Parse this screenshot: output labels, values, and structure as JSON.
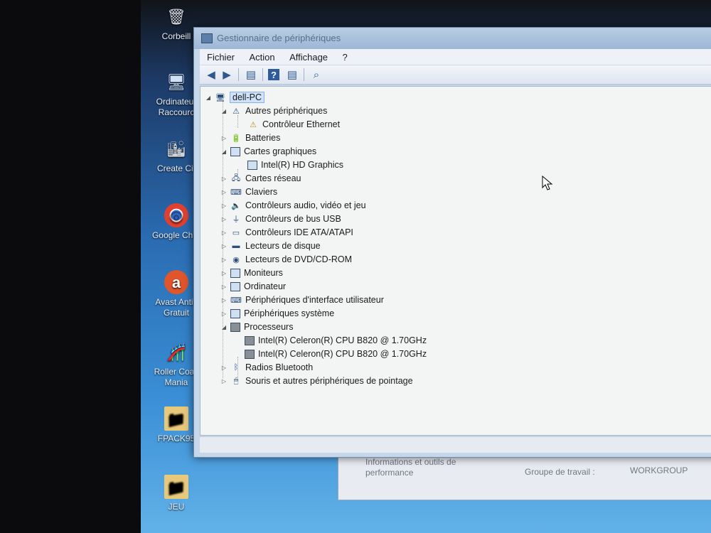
{
  "desktop": {
    "icons": [
      {
        "label": "Corbeill",
        "glyph": "🗑"
      },
      {
        "label": "Ordinateur\nRaccourc",
        "glyph": "🖥"
      },
      {
        "label": "Create Cit",
        "glyph": "🏙"
      },
      {
        "label": "Google Chro",
        "glyph": "◎"
      },
      {
        "label": "Avast Antiv\nGratuit",
        "glyph": "a"
      },
      {
        "label": "Roller Coas\nMania",
        "glyph": "🎢"
      },
      {
        "label": "FPACK95",
        "glyph": "📁"
      },
      {
        "label": "JEU",
        "glyph": "📁"
      }
    ]
  },
  "background_window": {
    "info_label": "Informations et outils de performance",
    "workgroup_label": "Groupe de travail :",
    "workgroup_value": "WORKGROUP"
  },
  "window": {
    "title": "Gestionnaire de périphériques",
    "menu": [
      "Fichier",
      "Action",
      "Affichage",
      "?"
    ],
    "toolbar": [
      "back-arrow-icon",
      "forward-arrow-icon",
      "properties-icon",
      "help-icon",
      "view-icon",
      "scan-hardware-icon"
    ]
  },
  "tree": {
    "root": "dell-PC",
    "items": [
      {
        "label": "Autres périphériques",
        "level": 1,
        "expanded": true,
        "icon": "warning-device-icon"
      },
      {
        "label": "Contrôleur Ethernet",
        "level": 2,
        "icon": "warning-device-icon"
      },
      {
        "label": "Batteries",
        "level": 1,
        "expanded": false,
        "icon": "battery-icon"
      },
      {
        "label": "Cartes graphiques",
        "level": 1,
        "expanded": true,
        "icon": "display-adapter-icon"
      },
      {
        "label": "Intel(R) HD Graphics",
        "level": 2,
        "icon": "display-adapter-icon"
      },
      {
        "label": "Cartes réseau",
        "level": 1,
        "expanded": false,
        "icon": "network-icon"
      },
      {
        "label": "Claviers",
        "level": 1,
        "expanded": false,
        "icon": "keyboard-icon"
      },
      {
        "label": "Contrôleurs audio, vidéo et jeu",
        "level": 1,
        "expanded": false,
        "icon": "audio-icon"
      },
      {
        "label": "Contrôleurs de bus USB",
        "level": 1,
        "expanded": false,
        "icon": "usb-icon"
      },
      {
        "label": "Contrôleurs IDE ATA/ATAPI",
        "level": 1,
        "expanded": false,
        "icon": "ide-icon"
      },
      {
        "label": "Lecteurs de disque",
        "level": 1,
        "expanded": false,
        "icon": "disk-icon"
      },
      {
        "label": "Lecteurs de DVD/CD-ROM",
        "level": 1,
        "expanded": false,
        "icon": "dvd-icon"
      },
      {
        "label": "Moniteurs",
        "level": 1,
        "expanded": false,
        "icon": "monitor-icon"
      },
      {
        "label": "Ordinateur",
        "level": 1,
        "expanded": false,
        "icon": "computer-icon"
      },
      {
        "label": "Périphériques d'interface utilisateur",
        "level": 1,
        "expanded": false,
        "icon": "hid-icon"
      },
      {
        "label": "Périphériques système",
        "level": 1,
        "expanded": false,
        "icon": "system-icon"
      },
      {
        "label": "Processeurs",
        "level": 1,
        "expanded": true,
        "icon": "processor-icon"
      },
      {
        "label": "Intel(R) Celeron(R) CPU B820 @ 1.70GHz",
        "level": 2,
        "icon": "processor-icon"
      },
      {
        "label": "Intel(R) Celeron(R) CPU B820 @ 1.70GHz",
        "level": 2,
        "icon": "processor-icon"
      },
      {
        "label": "Radios Bluetooth",
        "level": 1,
        "expanded": false,
        "icon": "bluetooth-icon"
      },
      {
        "label": "Souris et autres périphériques de pointage",
        "level": 1,
        "expanded": false,
        "icon": "mouse-icon"
      }
    ]
  }
}
